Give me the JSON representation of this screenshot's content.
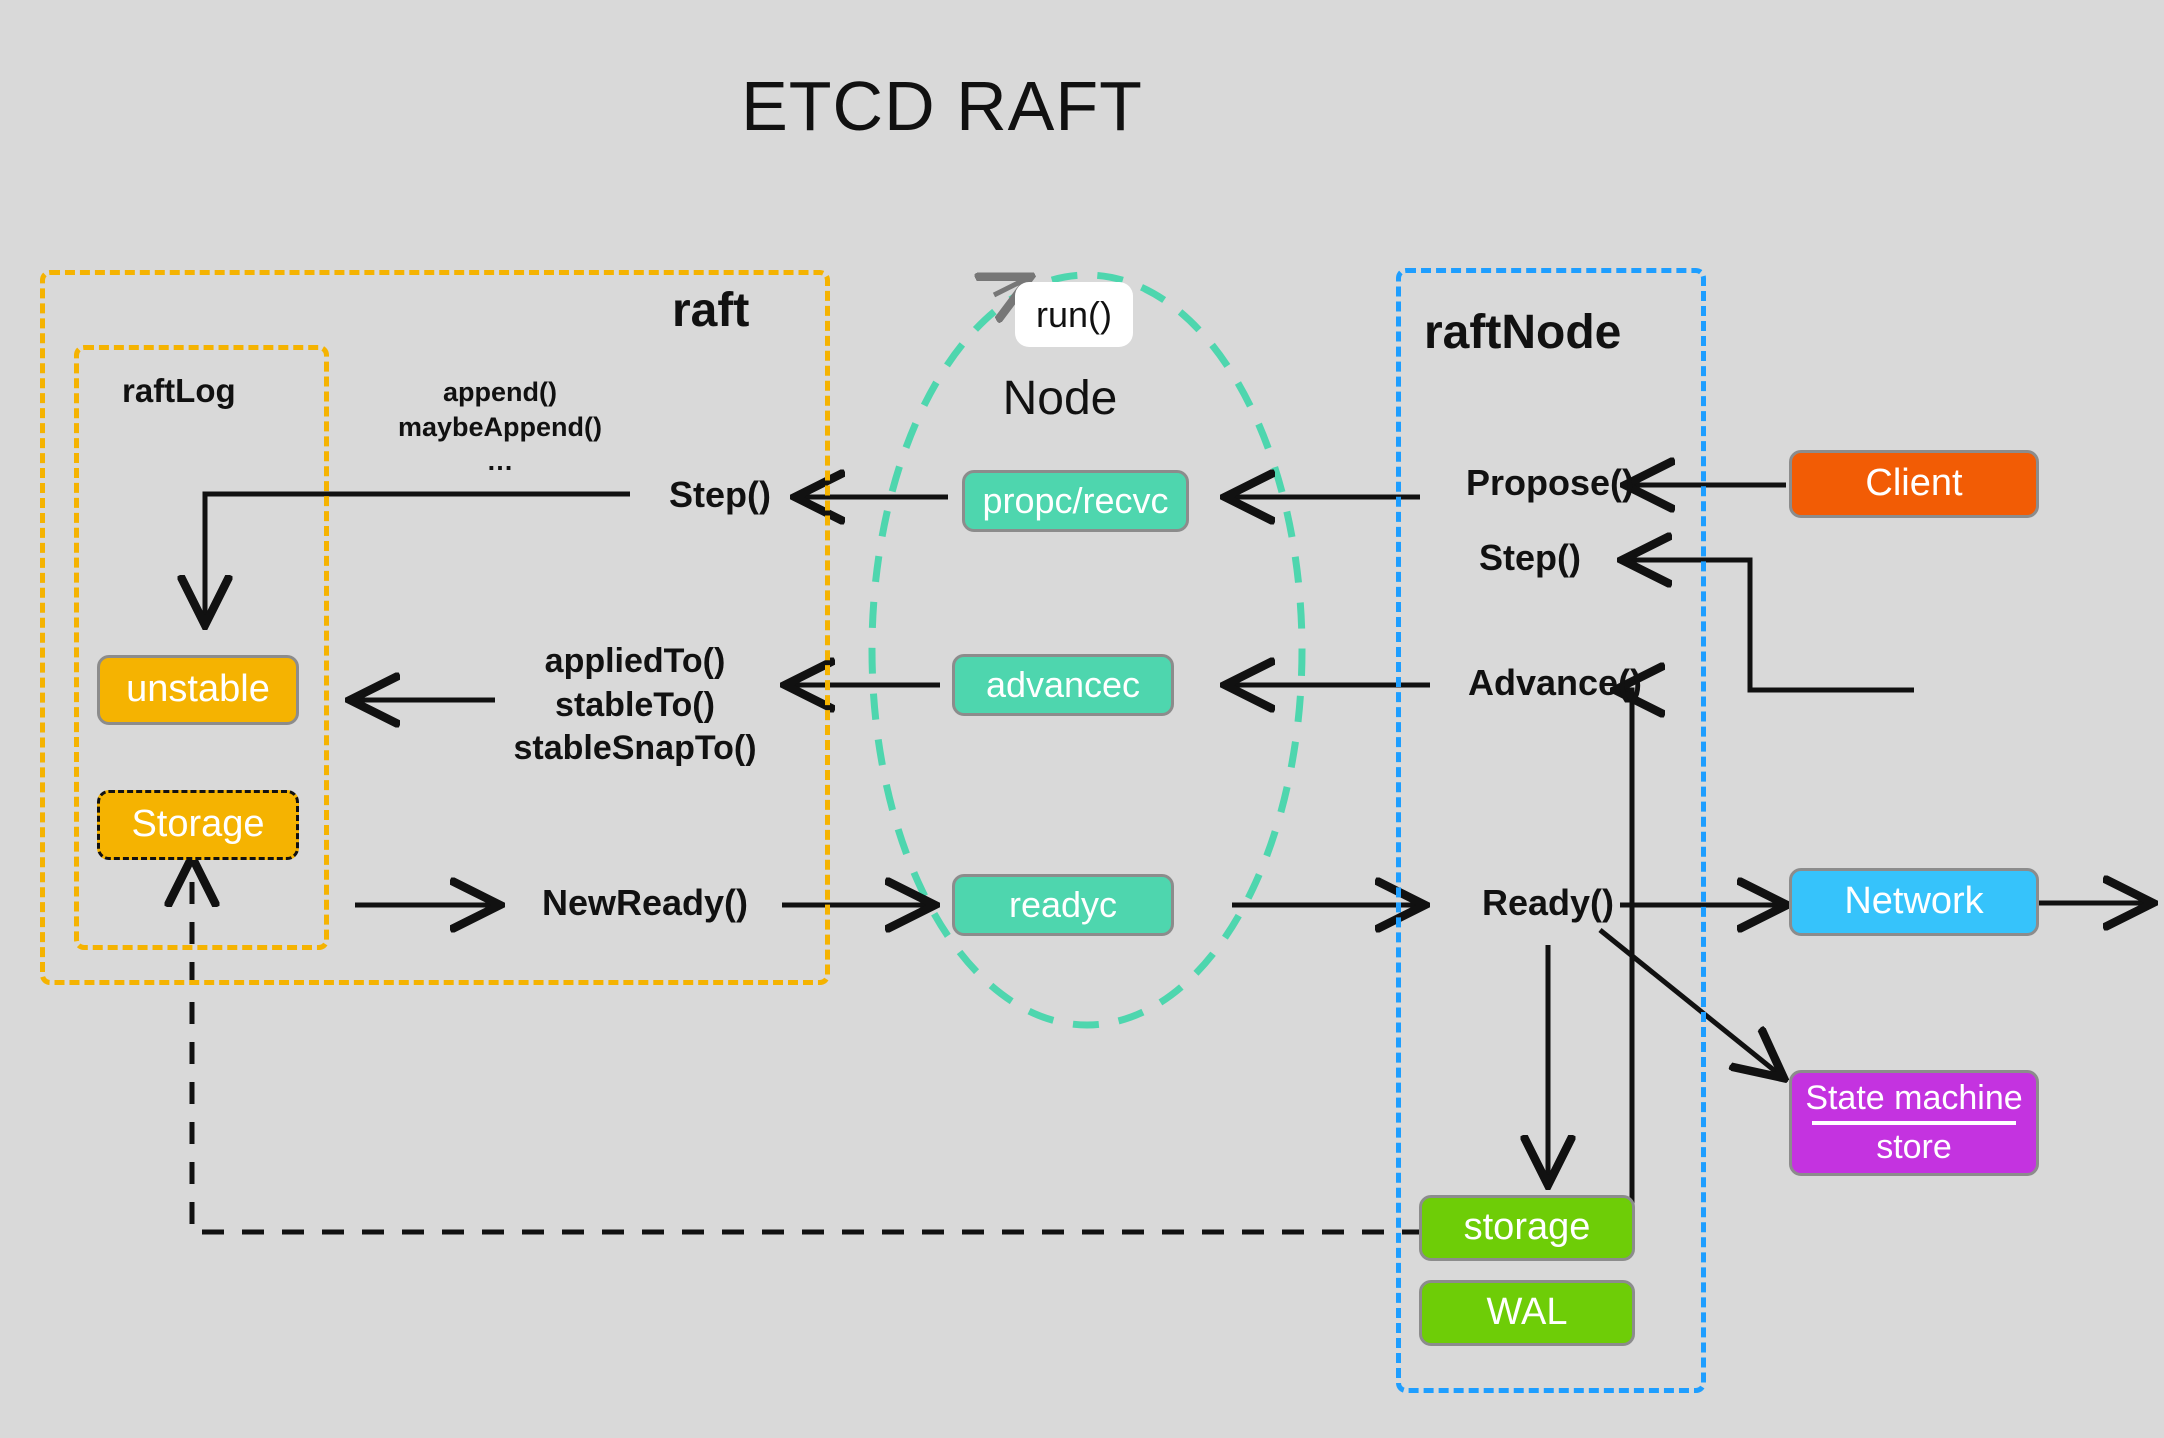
{
  "title": "ETCD RAFT",
  "panels": {
    "raft": {
      "label": "raft",
      "color": "#f5b301"
    },
    "raftlog": {
      "label": "raftLog",
      "color": "#f5b301"
    },
    "raftnode": {
      "label": "raftNode",
      "color": "#1e9eff"
    }
  },
  "node_group": {
    "label": "Node",
    "run_label": "run()",
    "ellipse_color": "#4ed6ae"
  },
  "boxes": [
    {
      "id": "unstable",
      "label": "unstable",
      "color": "#f5b301",
      "border": "#8c8c8c",
      "border_style": "solid"
    },
    {
      "id": "storage_raft",
      "label": "Storage",
      "color": "#f5b301",
      "border": "#111111",
      "border_style": "dashed"
    },
    {
      "id": "propc_recvc",
      "label": "propc/recvc",
      "color": "#4ed6ae",
      "border": "#8c8c8c",
      "border_style": "solid"
    },
    {
      "id": "advancec",
      "label": "advancec",
      "color": "#4ed6ae",
      "border": "#8c8c8c",
      "border_style": "solid"
    },
    {
      "id": "readyc",
      "label": "readyc",
      "color": "#4ed6ae",
      "border": "#8c8c8c",
      "border_style": "solid"
    },
    {
      "id": "client",
      "label": "Client",
      "color": "#f25c05",
      "border": "#8c8c8c",
      "border_style": "solid"
    },
    {
      "id": "network",
      "label": "Network",
      "color": "#36c3fb",
      "border": "#8c8c8c",
      "border_style": "solid"
    },
    {
      "id": "state_machine",
      "label_top": "State machine",
      "label_bottom": "store",
      "color": "#c433e0",
      "border": "#8c8c8c",
      "border_style": "solid"
    },
    {
      "id": "storage_node",
      "label": "storage",
      "color": "#6ecd07",
      "border": "#8c8c8c",
      "border_style": "solid"
    },
    {
      "id": "wal",
      "label": "WAL",
      "color": "#6ecd07",
      "border": "#8c8c8c",
      "border_style": "solid"
    }
  ],
  "labels": {
    "append_group": "append()\nmaybeAppend()\n…",
    "step_raft": "Step()",
    "applied_group": "appliedTo()\nstableTo()\nstableSnapTo()",
    "newready": "NewReady()",
    "propose": "Propose()",
    "step_node": "Step()",
    "advance": "Advance()",
    "ready": "Ready()"
  }
}
